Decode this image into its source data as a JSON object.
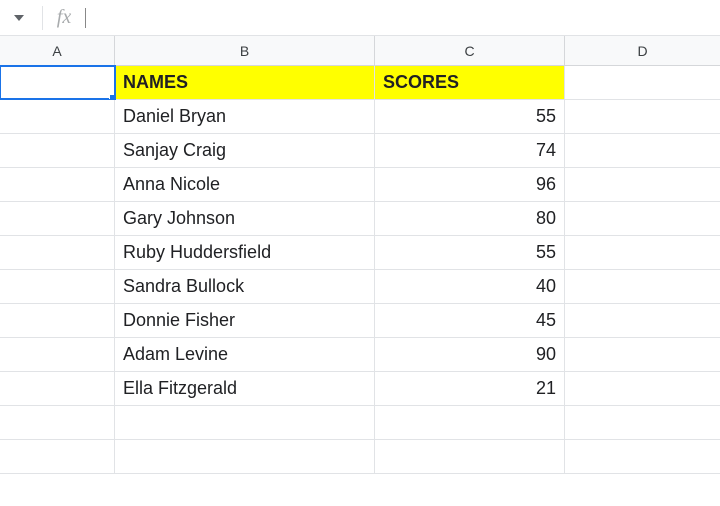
{
  "formula_bar": {
    "fx_label": "fx",
    "value": ""
  },
  "columns": [
    {
      "id": "A",
      "label": "A",
      "class": "col-A"
    },
    {
      "id": "B",
      "label": "B",
      "class": "col-B"
    },
    {
      "id": "C",
      "label": "C",
      "class": "col-C"
    },
    {
      "id": "D",
      "label": "D",
      "class": "col-D"
    }
  ],
  "header_row": {
    "names_label": "NAMES",
    "scores_label": "SCORES"
  },
  "chart_data": {
    "type": "table",
    "title": "",
    "columns": [
      "NAMES",
      "SCORES"
    ],
    "rows": [
      {
        "name": "Daniel Bryan",
        "score": 55
      },
      {
        "name": "Sanjay Craig",
        "score": 74
      },
      {
        "name": "Anna Nicole",
        "score": 96
      },
      {
        "name": "Gary Johnson",
        "score": 80
      },
      {
        "name": "Ruby Huddersfield",
        "score": 55
      },
      {
        "name": "Sandra Bullock",
        "score": 40
      },
      {
        "name": "Donnie Fisher",
        "score": 45
      },
      {
        "name": "Adam Levine",
        "score": 90
      },
      {
        "name": "Ella Fitzgerald",
        "score": 21
      }
    ]
  },
  "colors": {
    "highlight": "#ffff00",
    "active_border": "#1a73e8"
  }
}
